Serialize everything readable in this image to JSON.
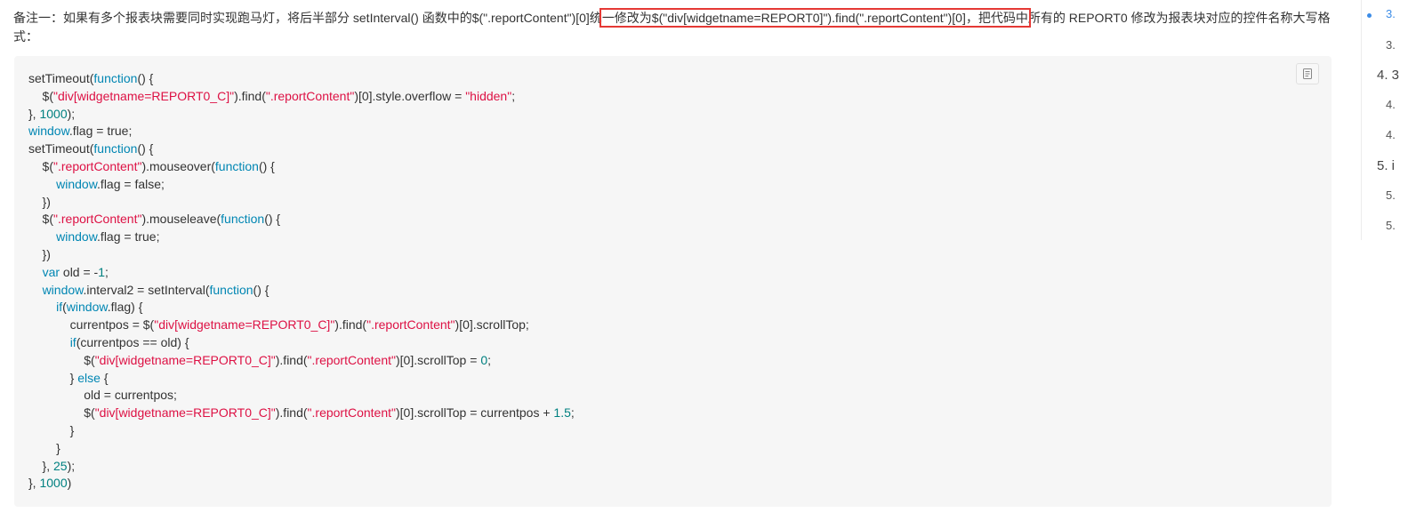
{
  "note": {
    "before": "备注一：如果有多个报表块需要同时实现跑马灯，将后半部分 setInterval() 函数中的$(\".reportContent\")[0]统",
    "highlighted": "一修改为$(\"div[widgetname=REPORT0]\").find(\".reportContent\")[0]，把代码中",
    "after": "所有的 REPORT0 修改为报表块对应的控件名称大写格式："
  },
  "code": {
    "lines": [
      [
        {
          "t": "setTimeout(",
          "c": "plain"
        },
        {
          "t": "function",
          "c": "kw"
        },
        {
          "t": "() {",
          "c": "plain"
        }
      ],
      [
        {
          "t": "    $(",
          "c": "plain"
        },
        {
          "t": "\"div[widgetname=REPORT0_C]\"",
          "c": "str"
        },
        {
          "t": ").find(",
          "c": "plain"
        },
        {
          "t": "\".reportContent\"",
          "c": "str"
        },
        {
          "t": ")[0].style.overflow = ",
          "c": "plain"
        },
        {
          "t": "\"hidden\"",
          "c": "str"
        },
        {
          "t": ";",
          "c": "plain"
        }
      ],
      [
        {
          "t": "}, ",
          "c": "plain"
        },
        {
          "t": "1000",
          "c": "num"
        },
        {
          "t": ");",
          "c": "plain"
        }
      ],
      [
        {
          "t": "window",
          "c": "kw"
        },
        {
          "t": ".flag = true;",
          "c": "plain"
        }
      ],
      [
        {
          "t": "setTimeout(",
          "c": "plain"
        },
        {
          "t": "function",
          "c": "kw"
        },
        {
          "t": "() {",
          "c": "plain"
        }
      ],
      [
        {
          "t": "    $(",
          "c": "plain"
        },
        {
          "t": "\".reportContent\"",
          "c": "str"
        },
        {
          "t": ").mouseover(",
          "c": "plain"
        },
        {
          "t": "function",
          "c": "kw"
        },
        {
          "t": "() {",
          "c": "plain"
        }
      ],
      [
        {
          "t": "        ",
          "c": "plain"
        },
        {
          "t": "window",
          "c": "kw"
        },
        {
          "t": ".flag = false;",
          "c": "plain"
        }
      ],
      [
        {
          "t": "    })",
          "c": "plain"
        }
      ],
      [
        {
          "t": "    $(",
          "c": "plain"
        },
        {
          "t": "\".reportContent\"",
          "c": "str"
        },
        {
          "t": ").mouseleave(",
          "c": "plain"
        },
        {
          "t": "function",
          "c": "kw"
        },
        {
          "t": "() {",
          "c": "plain"
        }
      ],
      [
        {
          "t": "        ",
          "c": "plain"
        },
        {
          "t": "window",
          "c": "kw"
        },
        {
          "t": ".flag = true;",
          "c": "plain"
        }
      ],
      [
        {
          "t": "    })",
          "c": "plain"
        }
      ],
      [
        {
          "t": "    ",
          "c": "plain"
        },
        {
          "t": "var",
          "c": "kw"
        },
        {
          "t": " old = -",
          "c": "plain"
        },
        {
          "t": "1",
          "c": "num"
        },
        {
          "t": ";",
          "c": "plain"
        }
      ],
      [
        {
          "t": "    ",
          "c": "plain"
        },
        {
          "t": "window",
          "c": "kw"
        },
        {
          "t": ".interval2 = setInterval(",
          "c": "plain"
        },
        {
          "t": "function",
          "c": "kw"
        },
        {
          "t": "() {",
          "c": "plain"
        }
      ],
      [
        {
          "t": "        ",
          "c": "plain"
        },
        {
          "t": "if",
          "c": "kw"
        },
        {
          "t": "(",
          "c": "plain"
        },
        {
          "t": "window",
          "c": "kw"
        },
        {
          "t": ".flag) {",
          "c": "plain"
        }
      ],
      [
        {
          "t": "            currentpos = $(",
          "c": "plain"
        },
        {
          "t": "\"div[widgetname=REPORT0_C]\"",
          "c": "str"
        },
        {
          "t": ").find(",
          "c": "plain"
        },
        {
          "t": "\".reportContent\"",
          "c": "str"
        },
        {
          "t": ")[0].scrollTop;",
          "c": "plain"
        }
      ],
      [
        {
          "t": "            ",
          "c": "plain"
        },
        {
          "t": "if",
          "c": "kw"
        },
        {
          "t": "(currentpos == old) {",
          "c": "plain"
        }
      ],
      [
        {
          "t": "                $(",
          "c": "plain"
        },
        {
          "t": "\"div[widgetname=REPORT0_C]\"",
          "c": "str"
        },
        {
          "t": ").find(",
          "c": "plain"
        },
        {
          "t": "\".reportContent\"",
          "c": "str"
        },
        {
          "t": ")[0].scrollTop = ",
          "c": "plain"
        },
        {
          "t": "0",
          "c": "num"
        },
        {
          "t": ";",
          "c": "plain"
        }
      ],
      [
        {
          "t": "            } ",
          "c": "plain"
        },
        {
          "t": "else",
          "c": "kw"
        },
        {
          "t": " {",
          "c": "plain"
        }
      ],
      [
        {
          "t": "                old = currentpos;",
          "c": "plain"
        }
      ],
      [
        {
          "t": "                $(",
          "c": "plain"
        },
        {
          "t": "\"div[widgetname=REPORT0_C]\"",
          "c": "str"
        },
        {
          "t": ").find(",
          "c": "plain"
        },
        {
          "t": "\".reportContent\"",
          "c": "str"
        },
        {
          "t": ")[0].scrollTop = currentpos + ",
          "c": "plain"
        },
        {
          "t": "1.5",
          "c": "num"
        },
        {
          "t": ";",
          "c": "plain"
        }
      ],
      [
        {
          "t": "            }",
          "c": "plain"
        }
      ],
      [
        {
          "t": "        }",
          "c": "plain"
        }
      ],
      [
        {
          "t": "    }, ",
          "c": "plain"
        },
        {
          "t": "25",
          "c": "num"
        },
        {
          "t": ");",
          "c": "plain"
        }
      ],
      [
        {
          "t": "}, ",
          "c": "plain"
        },
        {
          "t": "1000",
          "c": "num"
        },
        {
          "t": ")",
          "c": "plain"
        }
      ]
    ]
  },
  "toc": {
    "items": [
      {
        "label": "3.",
        "level": 2,
        "active": true
      },
      {
        "label": "3.",
        "level": 2,
        "active": false
      },
      {
        "label": "4. 3",
        "level": 1,
        "active": false
      },
      {
        "label": "4.",
        "level": 2,
        "active": false
      },
      {
        "label": "4.",
        "level": 2,
        "active": false
      },
      {
        "label": "5. i",
        "level": 1,
        "active": false
      },
      {
        "label": "5.",
        "level": 2,
        "active": false
      },
      {
        "label": "5.",
        "level": 2,
        "active": false
      }
    ]
  },
  "colors": {
    "keyword": "#0086b3",
    "string": "#dd1144",
    "number": "#008080",
    "highlight_border": "#e53935",
    "toc_active": "#3c8ce7"
  }
}
